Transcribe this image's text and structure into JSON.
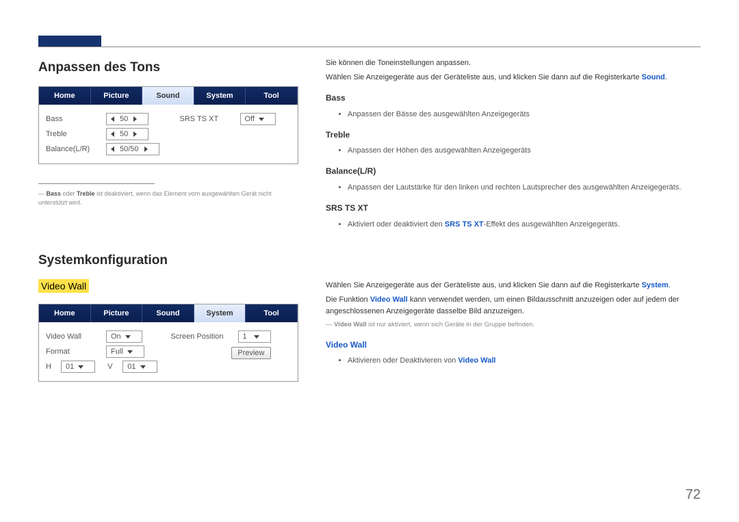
{
  "sections": {
    "sound": {
      "title": "Anpassen des Tons",
      "tabs": [
        "Home",
        "Picture",
        "Sound",
        "System",
        "Tool"
      ],
      "activeTab": "Sound",
      "fields": {
        "bass": {
          "label": "Bass",
          "value": "50"
        },
        "treble": {
          "label": "Treble",
          "value": "50"
        },
        "balance": {
          "label": "Balance(L/R)",
          "value": "50/50"
        },
        "srs": {
          "label": "SRS TS XT",
          "value": "Off"
        }
      },
      "footnote_pre": "―",
      "footnote_kw1": "Bass",
      "footnote_mid1": " oder ",
      "footnote_kw2": "Treble",
      "footnote_rest": " ist deaktiviert, wenn das Element vom ausgewählten Gerät nicht unterstützt wird."
    },
    "system": {
      "title": "Systemkonfiguration",
      "subtitle": "Video Wall",
      "tabs": [
        "Home",
        "Picture",
        "Sound",
        "System",
        "Tool"
      ],
      "activeTab": "System",
      "fields": {
        "videowall": {
          "label": "Video Wall",
          "value": "On"
        },
        "format": {
          "label": "Format",
          "value": "Full"
        },
        "h": {
          "label": "H",
          "value": "01"
        },
        "v": {
          "label": "V",
          "value": "01"
        },
        "screenpos": {
          "label": "Screen Position",
          "value": "1"
        },
        "preview": {
          "label": "Preview"
        }
      }
    }
  },
  "right": {
    "sound": {
      "intro1": "Sie können die Toneinstellungen anpassen.",
      "intro2_pre": "Wählen Sie Anzeigegeräte aus der Geräteliste aus, und klicken Sie dann auf die Registerkarte ",
      "intro2_kw": "Sound",
      "intro2_post": ".",
      "bass": {
        "h": "Bass",
        "li": "Anpassen der Bässe des ausgewählten Anzeigegeräts"
      },
      "treble": {
        "h": "Treble",
        "li": "Anpassen der Höhen des ausgewählten Anzeigegeräts"
      },
      "balance": {
        "h": "Balance(L/R)",
        "li": "Anpassen der Lautstärke für den linken und rechten Lautsprecher des ausgewählten Anzeigegeräts."
      },
      "srs": {
        "h": "SRS TS XT",
        "li_pre": "Aktiviert oder deaktiviert den ",
        "li_kw": "SRS TS XT",
        "li_post": "-Effekt des ausgewählten Anzeigegeräts."
      }
    },
    "system": {
      "intro_pre": "Wählen Sie Anzeigegeräte aus der Geräteliste aus, und klicken Sie dann auf die Registerkarte ",
      "intro_kw": "System",
      "intro_post": ".",
      "desc_pre": "Die Funktion ",
      "desc_kw": "Video Wall",
      "desc_post": " kann verwendet werden, um einen Bildausschnitt anzuzeigen oder auf jedem der angeschlossenen Anzeigegeräte dasselbe Bild anzuzeigen.",
      "note_dash": "―",
      "note_kw": "Video Wall",
      "note_rest": " ist nur aktiviert, wenn sich Geräte in der Gruppe befinden.",
      "vw": {
        "h": "Video Wall",
        "li_pre": "Aktivieren oder Deaktivieren von ",
        "li_kw": "Video Wall"
      }
    }
  },
  "pageNumber": "72"
}
